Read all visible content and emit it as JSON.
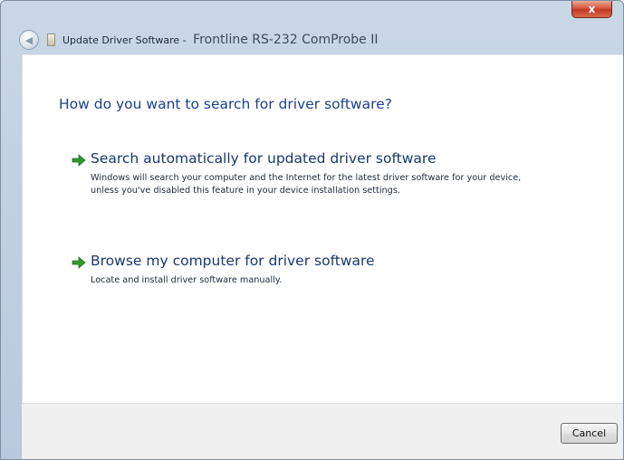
{
  "window": {
    "close_glyph": "x"
  },
  "nav": {
    "title_prefix": "Update Driver Software -",
    "title_device": "Frontline RS-232 ComProbe II"
  },
  "main": {
    "heading": "How do you want to search for driver software?",
    "options": [
      {
        "title": "Search automatically for updated driver software",
        "description": "Windows will search your computer and the Internet for the latest driver software for your device, unless you've disabled this feature in your device installation settings.",
        "icon": "green-arrow-icon"
      },
      {
        "title": "Browse my computer for driver software",
        "description": "Locate and install driver software manually.",
        "icon": "green-arrow-icon"
      }
    ]
  },
  "footer": {
    "cancel_label": "Cancel"
  },
  "colors": {
    "heading": "#1c3f8e",
    "arrow": "#2f9a2f",
    "close_button": "#c9432b"
  }
}
